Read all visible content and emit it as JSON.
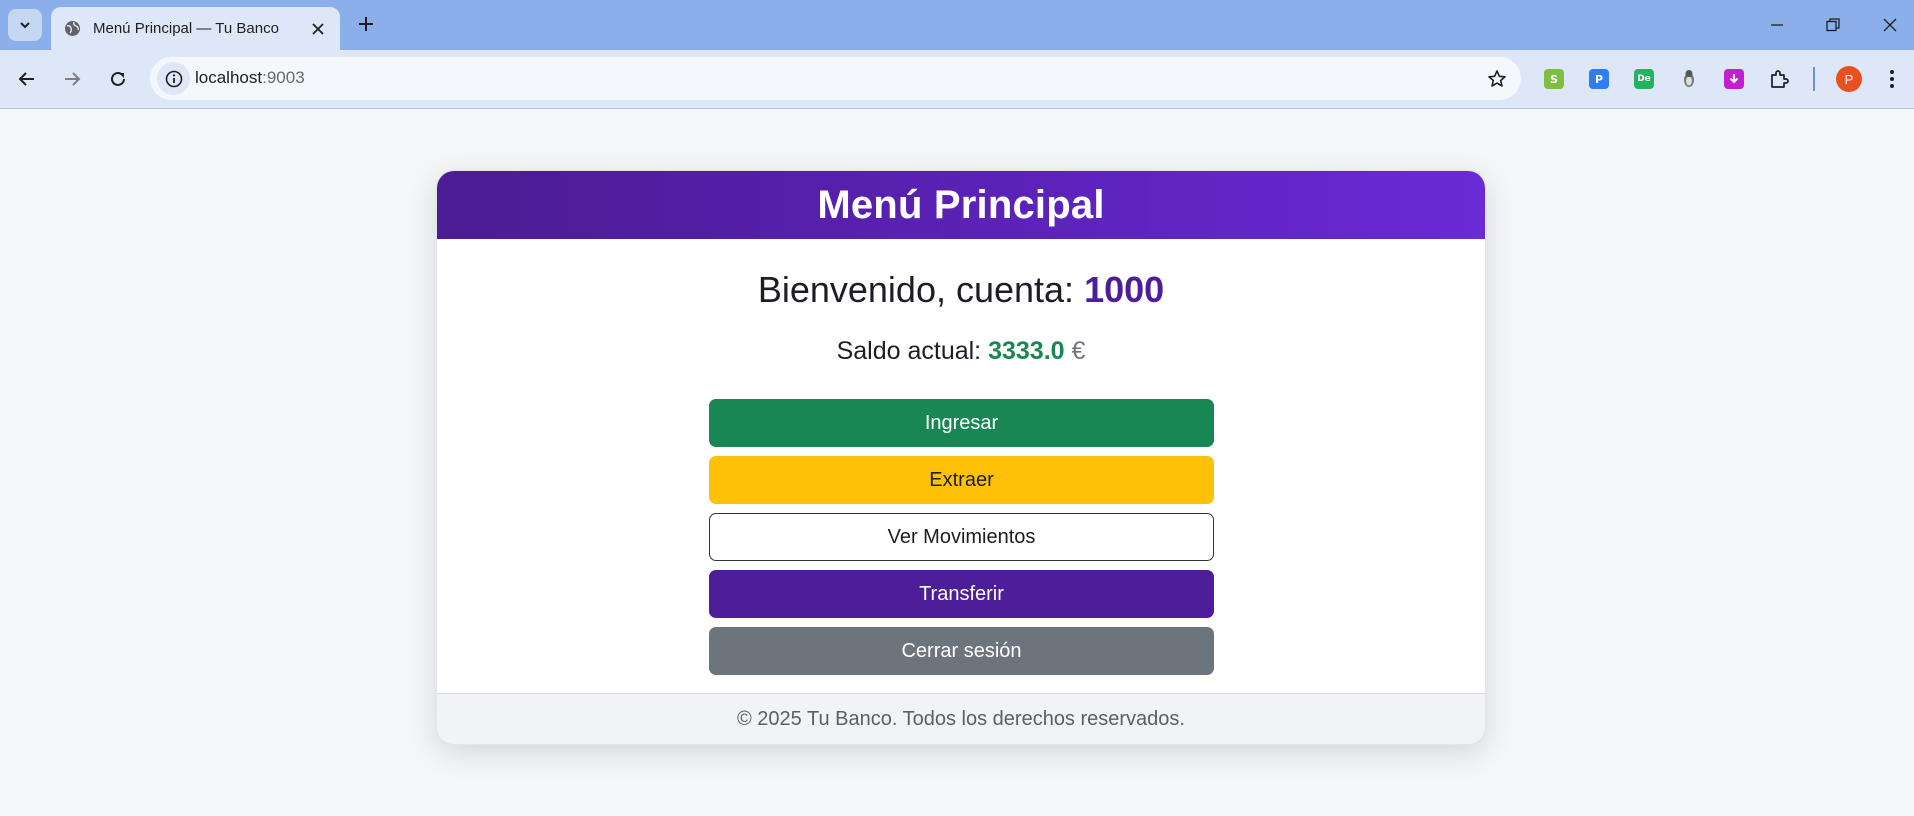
{
  "browser": {
    "tab_title": "Menú Principal — Tu Banco",
    "url_host": "localhost",
    "url_port": ":9003",
    "profile_initial": "P"
  },
  "page": {
    "header_title": "Menú Principal",
    "welcome_prefix": "Bienvenido, cuenta: ",
    "account_number": "1000",
    "balance_prefix": "Saldo actual: ",
    "balance_amount": "3333.0",
    "currency": "€",
    "buttons": {
      "ingresar": "Ingresar",
      "extraer": "Extraer",
      "movimientos": "Ver Movimientos",
      "transferir": "Transferir",
      "cerrar": "Cerrar sesión"
    },
    "footer": "© 2025 Tu Banco. Todos los derechos reservados."
  },
  "colors": {
    "header_gradient_start": "#4b1c93",
    "header_gradient_end": "#6a2ad6",
    "success": "#198754",
    "warning": "#ffc107",
    "brand_purple": "#4e1d9a",
    "secondary": "#6c757d"
  },
  "icons": [
    "tab-search-icon",
    "globe-icon",
    "close-icon",
    "new-tab-icon",
    "minimize-icon",
    "restore-icon",
    "window-close-icon",
    "back-icon",
    "forward-icon",
    "reload-icon",
    "site-info-icon",
    "bookmark-star-icon",
    "extensions-icon",
    "menu-icon"
  ]
}
